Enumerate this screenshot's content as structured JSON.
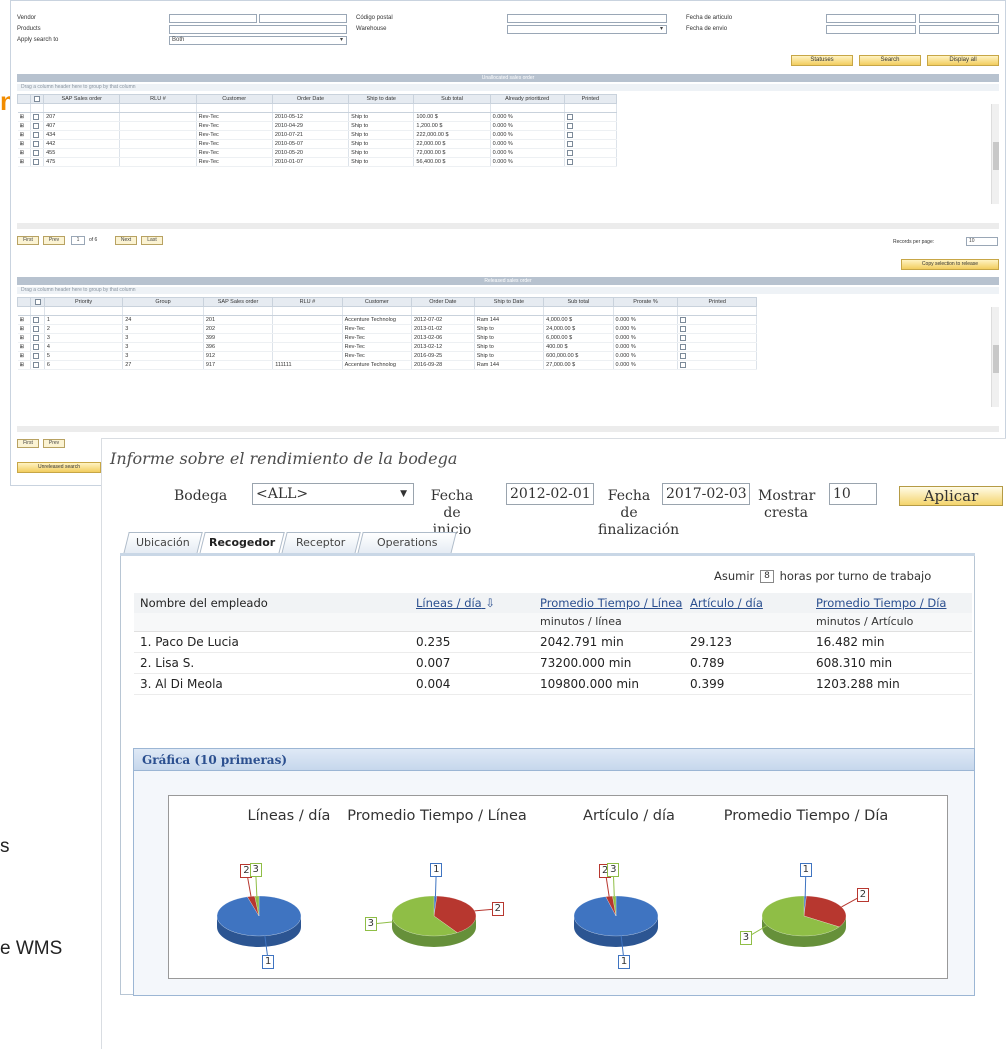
{
  "background_app": {
    "filters": {
      "left_labels": [
        "Vendor",
        "Products",
        "Apply search to"
      ],
      "apply_search_value": "Both",
      "mid_labels": [
        "Código postal",
        "Warehouse"
      ],
      "right_labels": [
        "Fecha de articulo",
        "Fecha de envio"
      ]
    },
    "buttons": [
      "Statuses",
      "Search",
      "Display all"
    ],
    "grid1": {
      "title": "Unallocated sales order",
      "group_hint": "Drag a column header here to group by that column",
      "headers": [
        "SAP Sales order",
        "RLU #",
        "Customer",
        "Order Date",
        "Ship to date",
        "Sub total",
        "Already prioritized",
        "Printed"
      ],
      "rows": [
        [
          "207",
          "",
          "Rev-Tec",
          "2010-05-12",
          "Ship to",
          "100.00 $",
          "0.000 %"
        ],
        [
          "407",
          "",
          "Rev-Tec",
          "2010-04-29",
          "Ship to",
          "1,200.00 $",
          "0.000 %"
        ],
        [
          "434",
          "",
          "Rev-Tec",
          "2010-07-21",
          "Ship to",
          "222,000.00 $",
          "0.000 %"
        ],
        [
          "442",
          "",
          "Rev-Tec",
          "2010-05-07",
          "Ship to",
          "22,000.00 $",
          "0.000 %"
        ],
        [
          "455",
          "",
          "Rev-Tec",
          "2010-05-20",
          "Ship to",
          "72,000.00 $",
          "0.000 %"
        ],
        [
          "475",
          "",
          "Rev-Tec",
          "2010-01-07",
          "Ship to",
          "56,400.00 $",
          "0.000 %"
        ]
      ],
      "pager": {
        "first": "First",
        "prev": "Prev",
        "page": "1",
        "of": "of 6",
        "next": "Next",
        "last": "Last"
      },
      "records_label": "Records per page:",
      "records_value": "10",
      "copy_button": "Copy selection to release"
    },
    "grid2": {
      "title": "Released sales order",
      "group_hint": "Drag a column header here to group by that column",
      "headers": [
        "Priority",
        "Group",
        "SAP Sales order",
        "RLU #",
        "Customer",
        "Order Date",
        "Ship to Date",
        "Sub total",
        "Prorate %",
        "Printed"
      ],
      "rows": [
        [
          "1",
          "24",
          "201",
          "",
          "Accenture Technolog",
          "2012-07-02",
          "Ram 144",
          "4,000.00 $",
          "0.000 %"
        ],
        [
          "2",
          "3",
          "202",
          "",
          "Rev-Tec",
          "2013-01-02",
          "Ship to",
          "24,000.00 $",
          "0.000 %"
        ],
        [
          "3",
          "3",
          "399",
          "",
          "Rev-Tec",
          "2013-02-06",
          "Ship to",
          "6,000.00 $",
          "0.000 %"
        ],
        [
          "4",
          "3",
          "396",
          "",
          "Rev-Tec",
          "2013-02-12",
          "Ship to",
          "400.00 $",
          "0.000 %"
        ],
        [
          "5",
          "3",
          "912",
          "",
          "Rev-Tec",
          "2016-09-25",
          "Ship to",
          "600,000.00 $",
          "0.000 %"
        ],
        [
          "6",
          "27",
          "917",
          "111111",
          "Accenture Technolog",
          "2016-09-28",
          "Ram 144",
          "27,000.00 $",
          "0.000 %"
        ]
      ],
      "pager": {
        "first": "First",
        "prev": "Prev"
      },
      "bottom_button": "Unreleased search"
    }
  },
  "side_fragments": {
    "orange_char": "n",
    "frag1": "s",
    "frag2": "e WMS"
  },
  "window": {
    "title": "Informe sobre el rendimiento de la bodega",
    "form": {
      "warehouse_label": "Bodega",
      "warehouse_value": "<ALL>",
      "start_label": "Fecha de inicio",
      "start_value": "2012-02-01",
      "end_label": "Fecha de finalización",
      "end_value": "2017-02-03",
      "top_label": "Mostrar cresta",
      "top_value": "10",
      "apply_label": "Aplicar"
    },
    "tabs": [
      "Ubicación",
      "Recogedor",
      "Receptor",
      "Operations"
    ],
    "active_tab": "Recogedor",
    "assume": {
      "prefix": "Asumir",
      "value": "8",
      "suffix": "horas por turno de trabajo"
    },
    "table": {
      "headers": [
        "Nombre del empleado",
        "Líneas / día",
        "Promedio Tiempo / Línea",
        "Artículo / día",
        "Promedio Tiempo / Día"
      ],
      "sort_indicator": "⇩",
      "units": [
        "",
        "",
        "minutos / línea",
        "",
        "minutos / Artículo"
      ],
      "rows": [
        [
          "1.  Paco De Lucia",
          "0.235",
          "2042.791 min",
          "29.123",
          "16.482 min"
        ],
        [
          "2.  Lisa S.",
          "0.007",
          "73200.000 min",
          "0.789",
          "608.310 min"
        ],
        [
          "3.  Al Di Meola",
          "0.004",
          "109800.000 min",
          "0.399",
          "1203.288 min"
        ]
      ]
    },
    "chart_panel_title": "Gráfica (10 primeras)"
  },
  "chart_data": [
    {
      "type": "pie",
      "title": "Líneas / día",
      "categories": [
        "1",
        "2",
        "3"
      ],
      "values": [
        0.235,
        0.007,
        0.004
      ]
    },
    {
      "type": "pie",
      "title": "Promedio Tiempo / Línea",
      "categories": [
        "1",
        "2",
        "3"
      ],
      "values": [
        2042.791,
        73200.0,
        109800.0
      ]
    },
    {
      "type": "pie",
      "title": "Artículo / día",
      "categories": [
        "1",
        "2",
        "3"
      ],
      "values": [
        29.123,
        0.789,
        0.399
      ]
    },
    {
      "type": "pie",
      "title": "Promedio Tiempo / Día",
      "categories": [
        "1",
        "2",
        "3"
      ],
      "values": [
        16.482,
        608.31,
        1203.288
      ]
    }
  ],
  "colors": {
    "slice1": "#3f74c1",
    "slice2": "#b7372f",
    "slice3": "#8fbe46",
    "accent": "#f28c00",
    "link": "#2b4f8f"
  }
}
